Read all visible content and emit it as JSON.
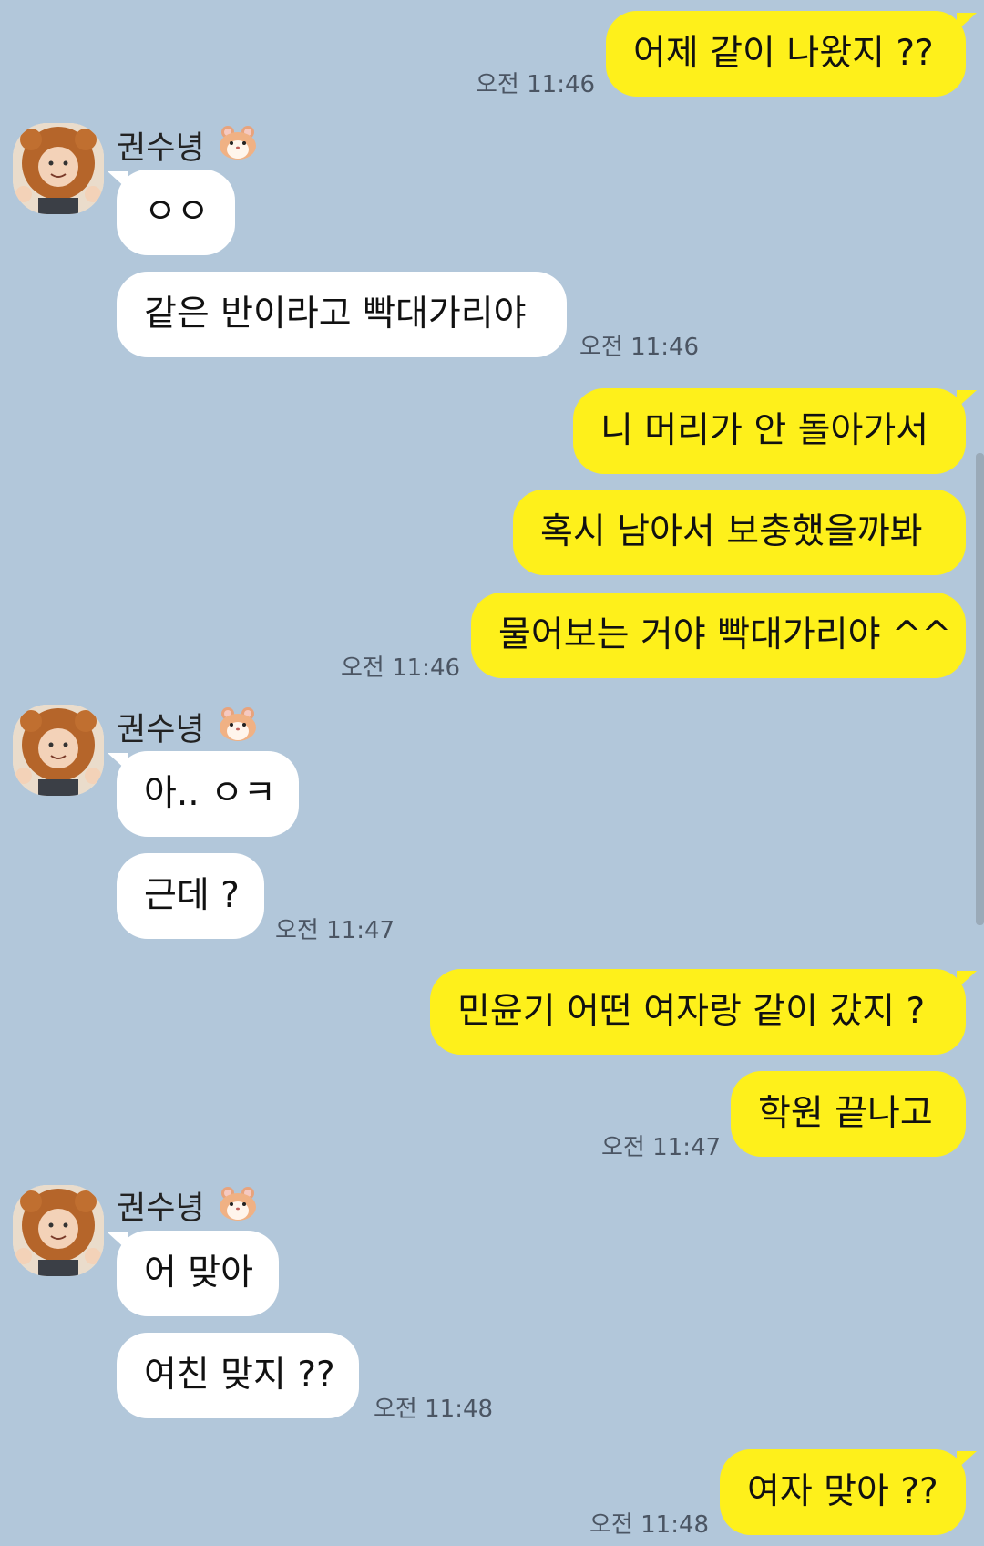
{
  "contact": {
    "name": "권수녕",
    "name_emoji": "hamster-emoji"
  },
  "colors": {
    "background": "#b2c7da",
    "my_bubble": "#fef01b",
    "their_bubble": "#ffffff",
    "time_text": "#4b5563"
  },
  "messages": [
    {
      "from": "me",
      "text": "어제 같이 나왔지 ??",
      "time": "오전 11:46"
    },
    {
      "from": "them",
      "text": "ㅇㅇ"
    },
    {
      "from": "them",
      "text": "같은 반이라고 빡대가리야",
      "time": "오전 11:46"
    },
    {
      "from": "me",
      "text": "니 머리가 안 돌아가서"
    },
    {
      "from": "me",
      "text": "혹시 남아서 보충했을까봐"
    },
    {
      "from": "me",
      "text": "물어보는 거야 빡대가리야 ^^",
      "time": "오전 11:46"
    },
    {
      "from": "them",
      "text": "아.. ㅇㅋ"
    },
    {
      "from": "them",
      "text": "근데 ?",
      "time": "오전 11:47"
    },
    {
      "from": "me",
      "text": "민윤기 어떤 여자랑 같이 갔지 ?"
    },
    {
      "from": "me",
      "text": "학원 끝나고",
      "time": "오전 11:47"
    },
    {
      "from": "them",
      "text": "어 맞아"
    },
    {
      "from": "them",
      "text": "여친 맞지 ??",
      "time": "오전 11:48"
    },
    {
      "from": "me",
      "text": "여자 맞아 ??",
      "time": "오전 11:48"
    }
  ]
}
